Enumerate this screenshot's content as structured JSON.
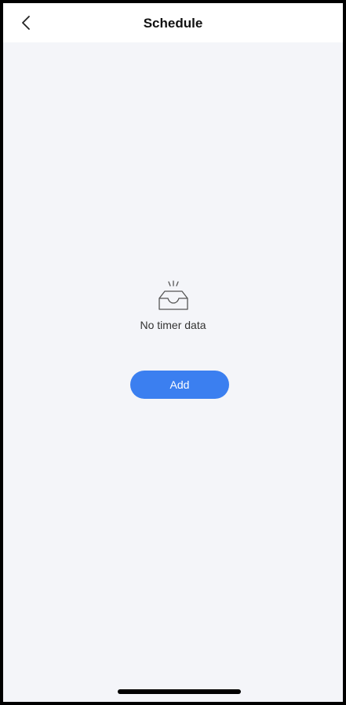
{
  "header": {
    "back_icon": "chevron-left-icon",
    "title": "Schedule"
  },
  "empty_state": {
    "icon": "empty-inbox-icon",
    "message": "No timer data"
  },
  "actions": {
    "add_label": "Add"
  },
  "colors": {
    "accent": "#3b7ff0",
    "background": "#f4f5f9",
    "header_background": "#ffffff"
  }
}
